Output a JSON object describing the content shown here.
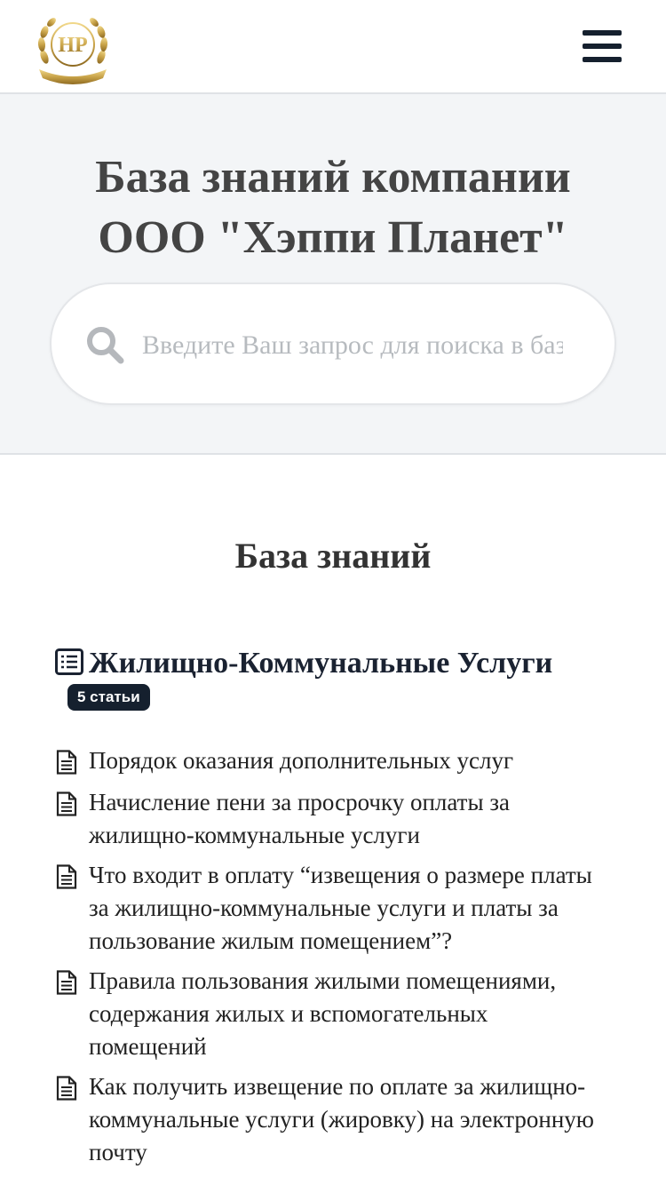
{
  "header": {
    "logo_text": "HP",
    "menu_icon": "hamburger-menu-icon"
  },
  "hero": {
    "title_line1": "База знаний компании",
    "title_line2": "ООО \"Хэппи Планет\"",
    "search_placeholder": "Введите Ваш запрос для поиска в базе знаний",
    "search_icon": "search-icon"
  },
  "knowledge_base": {
    "heading": "База знаний",
    "categories": [
      {
        "icon": "list-document-icon",
        "title": "Жилищно-Коммунальные Услуги",
        "badge": "5 статьи",
        "articles": [
          "Порядок оказания дополнительных услуг",
          "Начисление пени за просрочку оплаты за жилищно-коммунальные услуги",
          "Что входит в оплату “извещения о размере платы за жилищно-коммунальные услуги и платы за пользование жилым помещением”?",
          "Правила пользования жилыми помещениями, содержания жилых и вспомогательных помещений",
          "Как получить извещение по оплате за жилищно-коммунальные услуги (жировку) на электронную почту"
        ]
      }
    ]
  },
  "colors": {
    "brand_dark": "#15202e",
    "hero_bg": "#f3f5f7",
    "logo_gold": "#c9a44a"
  }
}
